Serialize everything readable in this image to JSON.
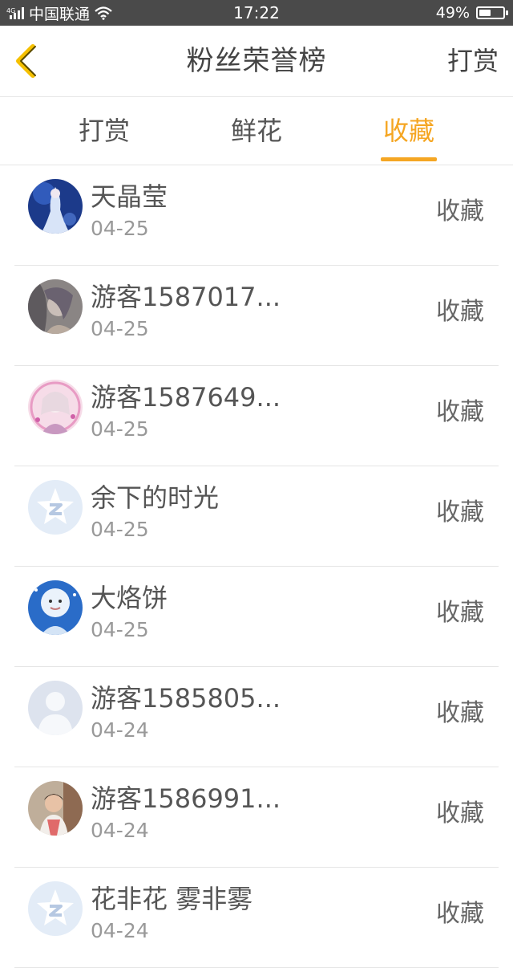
{
  "status_bar": {
    "carrier": "中国联通",
    "time": "17:22",
    "battery": "49%",
    "battery_level": 0.49
  },
  "header": {
    "title": "粉丝荣誉榜",
    "action": "打赏"
  },
  "tabs": [
    {
      "label": "打赏",
      "active": false
    },
    {
      "label": "鲜花",
      "active": false
    },
    {
      "label": "收藏",
      "active": true
    }
  ],
  "list": [
    {
      "name": "天晶莹",
      "date": "04-25",
      "action": "收藏",
      "avatar": "photo-fairy-blue"
    },
    {
      "name": "游客1587017...",
      "date": "04-25",
      "action": "收藏",
      "avatar": "photo-girl-gray"
    },
    {
      "name": "游客1587649...",
      "date": "04-25",
      "action": "收藏",
      "avatar": "photo-girl-pink"
    },
    {
      "name": "余下的时光",
      "date": "04-25",
      "action": "收藏",
      "avatar": "default-star-avatar"
    },
    {
      "name": "大烙饼",
      "date": "04-25",
      "action": "收藏",
      "avatar": "photo-moon-face"
    },
    {
      "name": "游客1585805...",
      "date": "04-24",
      "action": "收藏",
      "avatar": "default-person-avatar"
    },
    {
      "name": "游客1586991...",
      "date": "04-24",
      "action": "收藏",
      "avatar": "photo-woman"
    },
    {
      "name": "花非花 雾非雾",
      "date": "04-24",
      "action": "收藏",
      "avatar": "default-star-avatar"
    }
  ],
  "colors": {
    "accent": "#f5a623",
    "status_bar_bg": "#4a4a4a",
    "divider": "#e5e5e5"
  }
}
